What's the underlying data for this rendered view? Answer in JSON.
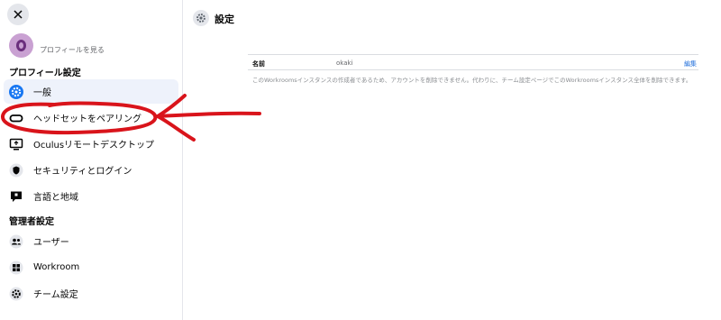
{
  "sidebar": {
    "close_icon": "close-icon",
    "profile_link": "プロフィールを見る",
    "section_profile": "プロフィール設定",
    "section_admin": "管理者設定",
    "profile_items": [
      {
        "label": "一般",
        "icon": "gear-icon",
        "active": true
      },
      {
        "label": "ヘッドセットをペアリング",
        "icon": "headset-icon",
        "active": false
      },
      {
        "label": "Oculusリモートデスクトップ",
        "icon": "monitor-icon",
        "active": false
      },
      {
        "label": "セキュリティとログイン",
        "icon": "shield-icon",
        "active": false
      },
      {
        "label": "言語と地域",
        "icon": "speech-bubble-icon",
        "active": false
      }
    ],
    "admin_items": [
      {
        "label": "ユーザー",
        "icon": "users-icon"
      },
      {
        "label": "Workroom",
        "icon": "grid-icon"
      },
      {
        "label": "チーム設定",
        "icon": "gear-icon"
      }
    ]
  },
  "main": {
    "title": "設定",
    "table": {
      "name_label": "名前",
      "name_value": "okaki",
      "edit_label": "編集"
    },
    "note": "このWorkroomsインスタンスの作成者であるため、アカウントを削除できません。代わりに、チーム設定ページでこのWorkroomsインスタンス全体を削除できます。"
  },
  "colors": {
    "active_bg": "#eef2fb",
    "link_blue": "#216fdb",
    "annotation_red": "#d9141b"
  }
}
